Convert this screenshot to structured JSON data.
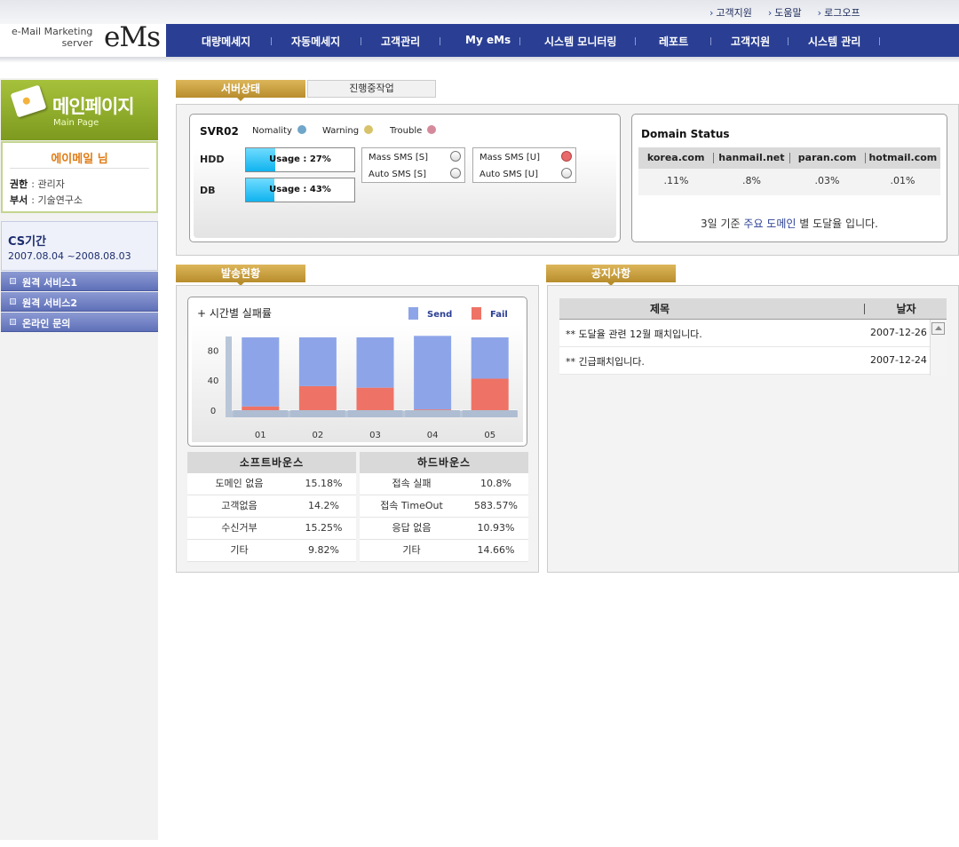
{
  "header": {
    "util_links": [
      "고객지원",
      "도움말",
      "로그오프"
    ],
    "logo_line1": "e-Mail Marketing",
    "logo_line2": "server",
    "logo_brand": "eMs",
    "nav": [
      "대량메세지",
      "자동메세지",
      "고객관리",
      "My eMs",
      "시스템 모니터링",
      "레포트",
      "고객지원",
      "시스템 관리"
    ]
  },
  "sidebar": {
    "main_title": "메인페이지",
    "main_sub": "Main Page",
    "user_name": "에이메일 님",
    "role_label": "권한",
    "role_value": ": 관리자",
    "dept_label": "부서",
    "dept_value": ": 기술연구소",
    "cs_title": "CS기간",
    "cs_period": "2007.08.04 ~2008.08.03",
    "menu": [
      "원격 서비스1",
      "원격 서비스2",
      "온라인 문의"
    ]
  },
  "server": {
    "tab_active": "서버상태",
    "tab_inactive": "진행중작업",
    "name": "SVR02",
    "legend": [
      {
        "label": "Nomality",
        "color": "#6fa6c9"
      },
      {
        "label": "Warning",
        "color": "#d8c36a"
      },
      {
        "label": "Trouble",
        "color": "#d58a9c"
      }
    ],
    "hdd_label": "HDD",
    "hdd_usage_text": "Usage : 27%",
    "hdd_usage": 0.27,
    "db_label": "DB",
    "db_usage_text": "Usage : 43%",
    "db_usage": 0.26,
    "sms_s": [
      "Mass SMS [S]",
      "Auto SMS [S]"
    ],
    "sms_u": [
      "Mass SMS [U]",
      "Auto SMS [U]"
    ],
    "sms_u_mass_alert": true
  },
  "domain_status": {
    "title": "Domain Status",
    "domains": [
      "korea.com",
      "hanmail.net",
      "paran.com",
      "hotmail.com"
    ],
    "values": [
      ".11%",
      ".8%",
      ".03%",
      ".01%"
    ],
    "note_pre": "3일 기준 ",
    "note_highlight": "주요 도메인",
    "note_post": " 별 도달율 입니다."
  },
  "send_status": {
    "tab": "발송현황",
    "chart_title": "+ 시간별 실패률",
    "legend_send": "Send",
    "legend_fail": "Fail",
    "send_color": "#8da5e8",
    "fail_color": "#ee7366"
  },
  "chart_data": {
    "type": "bar",
    "stacked": true,
    "title": "+ 시간별 실패률",
    "categories": [
      "01",
      "02",
      "03",
      "04",
      "05"
    ],
    "series": [
      {
        "name": "Send",
        "values": [
          92,
          65,
          67,
          98,
          55
        ]
      },
      {
        "name": "Fail",
        "values": [
          5,
          32,
          30,
          1,
          42
        ]
      }
    ],
    "yticks": [
      0,
      40,
      80
    ],
    "ylim": [
      0,
      97
    ],
    "legend_position": "top-right"
  },
  "soft_bounce": {
    "title": "소프트바운스",
    "rows": [
      {
        "label": "도메인 없음",
        "value": "15.18%"
      },
      {
        "label": "고객없음",
        "value": "14.2%"
      },
      {
        "label": "수신거부",
        "value": "15.25%"
      },
      {
        "label": "기타",
        "value": "9.82%"
      }
    ]
  },
  "hard_bounce": {
    "title": "하드바운스",
    "rows": [
      {
        "label": "접속 실패",
        "value": "10.8%"
      },
      {
        "label": "접속 TimeOut",
        "value": "583.57%"
      },
      {
        "label": "응답 없음",
        "value": "10.93%"
      },
      {
        "label": "기타",
        "value": "14.66%"
      }
    ]
  },
  "notice": {
    "tab": "공지사항",
    "col_title": "제목",
    "col_date": "날자",
    "items": [
      {
        "title": "** 도달율 관련 12월 패치입니다.",
        "date": "2007-12-26"
      },
      {
        "title": "** 긴급패치입니다.",
        "date": "2007-12-24"
      }
    ]
  }
}
